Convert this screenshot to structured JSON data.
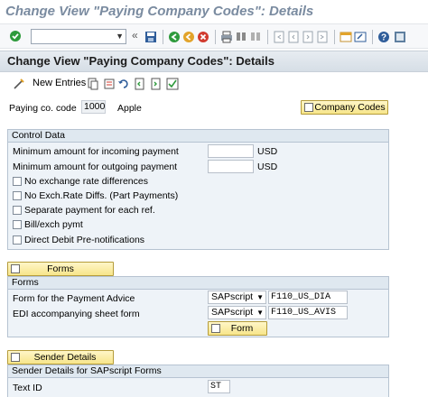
{
  "window": {
    "title": "Change View \"Paying Company Codes\": Details"
  },
  "system_toolbar": {
    "command_field_value": "",
    "icons": [
      "enter-icon",
      "back-icon",
      "exit-icon",
      "cancel-icon",
      "print-icon",
      "find-icon",
      "find-next-icon",
      "first-page-icon",
      "prev-page-icon",
      "next-page-icon",
      "last-page-icon",
      "new-session-icon",
      "shortcut-icon",
      "help-icon",
      "customize-layout-icon"
    ]
  },
  "screen": {
    "title": "Change View \"Paying Company Codes\": Details"
  },
  "app_toolbar": {
    "new_entries_label": "New Entries"
  },
  "header": {
    "paying_code_label": "Paying co. code",
    "paying_code_value": "1000",
    "company_name": "Apple",
    "company_codes_button": "Company Codes"
  },
  "control_data": {
    "title": "Control Data",
    "min_incoming_label": "Minimum amount for incoming payment",
    "min_incoming_value": "",
    "min_incoming_unit": "USD",
    "min_outgoing_label": "Minimum amount for outgoing payment",
    "min_outgoing_value": "",
    "min_outgoing_unit": "USD",
    "checkboxes": [
      {
        "label": "No exchange rate differences",
        "checked": false
      },
      {
        "label": "No Exch.Rate Diffs. (Part Payments)",
        "checked": false
      },
      {
        "label": "Separate payment for each ref.",
        "checked": false
      },
      {
        "label": "Bill/exch pymt",
        "checked": false
      },
      {
        "label": "Direct Debit Pre-notifications",
        "checked": false
      }
    ]
  },
  "forms_button": {
    "label": "Forms"
  },
  "forms": {
    "title": "Forms",
    "payment_advice_label": "Form for the Payment Advice",
    "payment_advice_type": "SAPscript",
    "payment_advice_value": "F110_US_DIA",
    "edi_label": "EDI accompanying sheet form",
    "edi_type": "SAPscript",
    "edi_value": "F110_US_AVIS",
    "form_button": "Form"
  },
  "sender_button": {
    "label": "Sender Details"
  },
  "sender": {
    "title": "Sender Details for SAPscript Forms",
    "text_id_label": "Text ID",
    "text_id_value": "ST"
  }
}
